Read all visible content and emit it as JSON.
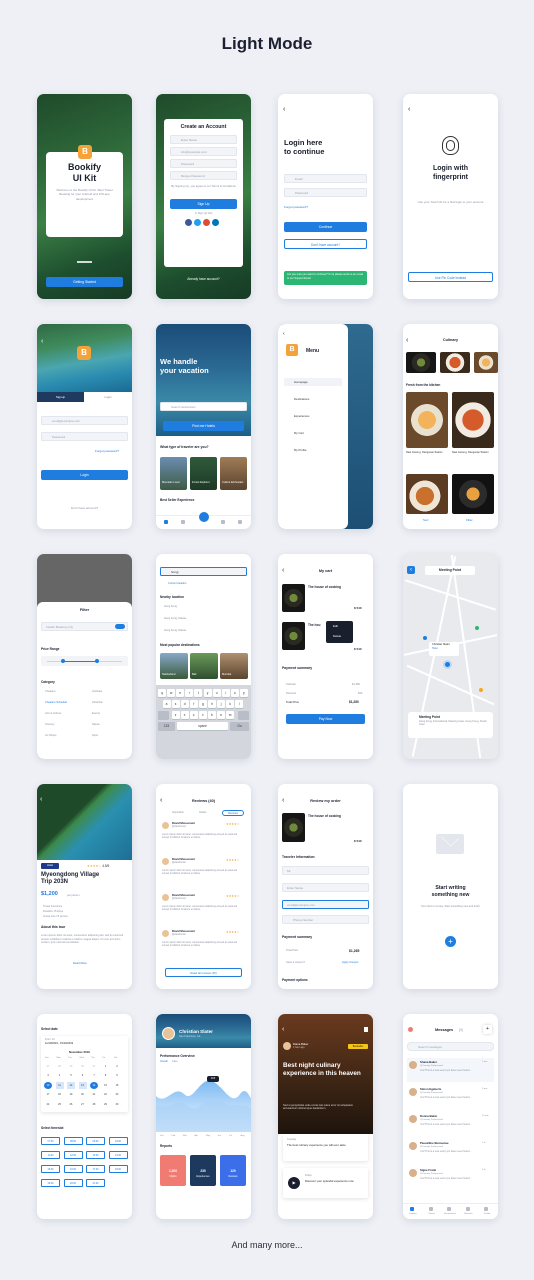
{
  "header": {
    "title": "Light Mode",
    "footer": "And many more..."
  },
  "colors": {
    "accent": "#1f7de0",
    "background": "#eef0f5",
    "star": "#f5a623"
  },
  "s1": {
    "logo": "B",
    "title": "Bookify\nUI Kit",
    "desc": "Welcome to the Bookify UI Kit. Best Travel Booking for your Android and iOS app development",
    "button": "Getting Started"
  },
  "s2": {
    "title": "Create an Account",
    "f1": "Enter Name",
    "f2": "info@example.com",
    "f3": "Password",
    "f4": "Retype Password",
    "terms": "By Signing Up, you agree to our Terms & Conditions",
    "button": "Sign Up",
    "or": "or Sign Up with",
    "login": "Already have account?"
  },
  "s3": {
    "title": "Login here\nto continue",
    "f1": "Email",
    "f2": "Password",
    "forgot": "Forgot password?",
    "btn1": "Continue",
    "btn2": "Don't have account?",
    "banner": "Are you sure you want to continue? If not please send us an email to our Support Email"
  },
  "s4": {
    "title": "Login with\nfingerprint",
    "desc": "Use your Touch ID for a fast login to your account",
    "button": "Use Pin Code Instead"
  },
  "s5": {
    "logo": "B",
    "tab1": "Signup",
    "tab2": "Login",
    "f1": "email@example.com",
    "f2": "Password",
    "forgot": "Forgot password?",
    "button": "Login",
    "noacc": "Don't have account?"
  },
  "s6": {
    "title": "We handle\nyour vacation",
    "search": "Search destination",
    "button": "Find me Hotels",
    "question": "What type of traveler are you?",
    "c1": "Mountain Lover",
    "c2": "Forest Explorer",
    "c3": "Culture Enthusiast",
    "best": "Best Seller Experience"
  },
  "s7": {
    "menu": "Menu",
    "items": [
      "Homepage",
      "Destinations",
      "Experiences",
      "My Cart",
      "My Profile"
    ]
  },
  "s8": {
    "title": "Culinary",
    "fresh": "Fresh from the kitchen",
    "i1": "Nasi Goreng, Dangsuan Station",
    "i2": "Nasi Goreng, Dangsuan Station",
    "sort": "Sort",
    "filter": "Filter"
  },
  "s9": {
    "title": "Filter",
    "toggle": "Instant Booking only",
    "price": "Price Range",
    "cat": "Category",
    "cats": [
      "Cheaters",
      "Activities",
      "Cheaters Schedule",
      "Attraction",
      "Arts & Culture",
      "Events",
      "Scenery",
      "Nature",
      "Art Shops",
      "Sport"
    ]
  },
  "s10": {
    "search": "hong|",
    "suggest": "Current location",
    "nearby": "Nearby location",
    "loc1": "Hong Kong",
    "loc2": "Hong Kong, Macau",
    "loc3": "Hong Kong, Macau",
    "popular": "Most popular destinations",
    "d1": "Switzerland",
    "d2": "Bali",
    "d3": "Mumbai",
    "keys1": [
      "q",
      "w",
      "e",
      "r",
      "t",
      "y",
      "u",
      "i",
      "o",
      "p"
    ],
    "keys2": [
      "a",
      "s",
      "d",
      "f",
      "g",
      "h",
      "j",
      "k",
      "l"
    ],
    "keys3": [
      "z",
      "x",
      "c",
      "v",
      "b",
      "n",
      "m"
    ],
    "k123": "123",
    "space": "space",
    "go": "Go"
  },
  "s11": {
    "title": "My cart",
    "item1": "The house of cooking",
    "item2": "The hou",
    "edit": "Edit",
    "delete": "Delete",
    "price": "$ 540",
    "summary": "Payment summary",
    "sub": "Subtotal",
    "subv": "$1,280",
    "disc": "Discount",
    "discv": "$20",
    "total": "Total Price",
    "totalv": "$1,280",
    "button": "Pay Now"
  },
  "s12": {
    "title": "Meeting Point",
    "pin1": "Christian Slater",
    "pin1s": "Hotel",
    "meet": "Meeting Point",
    "addr": "Hong Kong International, Meeting Gate, Hong Kong, South Area"
  },
  "s13": {
    "badge": "Hotel",
    "rating": "4.5/5",
    "title": "Myeongdong Village\nTrip 203N",
    "price": "$1,200",
    "per": "per person",
    "f1": "Travel Insurance",
    "f2": "Duration 15 Days",
    "f3": "Group size 15 person",
    "about": "About this tour",
    "text": "Lorem ipsum dolor sit amet, consectetur adipiscing elit, sed do eiusmod tempor incididunt ut labore et dolore magna aliqua. Ut enim ad minim veniam, quis nostrud exercitation.",
    "read": "Read More"
  },
  "s14": {
    "title": "Reviews (40)",
    "tabs": [
      "Inspiration",
      "Hotels",
      "Reviews"
    ],
    "reviewer": "David Mussoneni",
    "sub": "@davidmuss",
    "text": "Lorem ipsum dolor sit amet, consectetur adipiscing elit sed do eiusmod tempor incididunt ut labore et dolore.",
    "button": "Read all reviews (40)"
  },
  "s15": {
    "title": "Review my order",
    "item": "The house of cooking",
    "price": "$ 540",
    "traveler": "Traveler Information",
    "f1": "Mr.",
    "f2": "Enter Name",
    "f3": "email@example.com",
    "f4": "Phone Number",
    "summary": "Payment summary",
    "total": "Total Price",
    "totalv": "$1,265",
    "promo": "Have a coupon?",
    "apply": "Apply Coupon",
    "options": "Payment options"
  },
  "s16": {
    "title": "Start writing\nsomething new",
    "desc": "Your inbox is empty. Start something new and fresh."
  },
  "s17": {
    "select": "Select date",
    "from": "From: 12",
    "range": "11/10/2019 - 15/10/2019",
    "month": "November 2019",
    "days": [
      "Sun",
      "Mon",
      "Tue",
      "Wed",
      "Thu",
      "Fri",
      "Sat"
    ],
    "dates": [
      "27",
      "28",
      "29",
      "30",
      "31",
      "1",
      "2",
      "3",
      "4",
      "5",
      "6",
      "7",
      "8",
      "9",
      "10",
      "11",
      "12",
      "13",
      "14",
      "15",
      "16",
      "17",
      "18",
      "19",
      "20",
      "21",
      "22",
      "23",
      "24",
      "25",
      "26",
      "27",
      "28",
      "29",
      "30"
    ],
    "timeslot": "Select timeslot",
    "slots": [
      "07:00",
      "08:00",
      "09:00",
      "10:00",
      "11:00",
      "12:00",
      "13:00",
      "14:00",
      "15:00",
      "16:00",
      "17:00",
      "18:00",
      "19:00",
      "20:00",
      "21:00"
    ]
  },
  "s18": {
    "name": "Christian Slater",
    "loc": "San Francisco, Ca",
    "perf": "Performance Overview",
    "tab1": "Overall",
    "tab2": "Likes",
    "value": "315",
    "months": [
      "Jan",
      "Feb",
      "Mar",
      "Apr",
      "May",
      "Jun",
      "Jul",
      "Aug"
    ],
    "reports": "Reports",
    "r1v": "1,200",
    "r1": "Flights",
    "r2v": "239",
    "r2": "Experiences",
    "r3v": "129",
    "r3": "Reviews"
  },
  "s19": {
    "author": "Diana Baker",
    "meta": "1 hour ago",
    "badge": "Bestseller",
    "title": "Best night culinary experience in this heaven",
    "text": "Sed ut perspiciatis unde omnis iste natus error sit voluptatem accusantium doloremque laudantium.",
    "c1": "Tuesday",
    "c1t": "The best culinary experience you will ever taste",
    "c2": "Friday",
    "c2t": "Discover your splendid experience now"
  },
  "s20": {
    "title": "Messages",
    "count": "(3)",
    "search": "Search messages",
    "names": [
      "Shana Baker",
      "Simon Egeberts",
      "Donna Baker",
      "Pascalline Bienvenue",
      "Signe Frank"
    ],
    "sub": "@Cmunity Professional",
    "msg": "Yes! This is a new event you have never heard...",
    "times": [
      "2 min",
      "5 min",
      "10 min",
      "1 hr",
      "2 hr"
    ],
    "tabs": [
      "Explore",
      "Saved",
      "Destinations",
      "Reviews",
      "Profile"
    ]
  }
}
